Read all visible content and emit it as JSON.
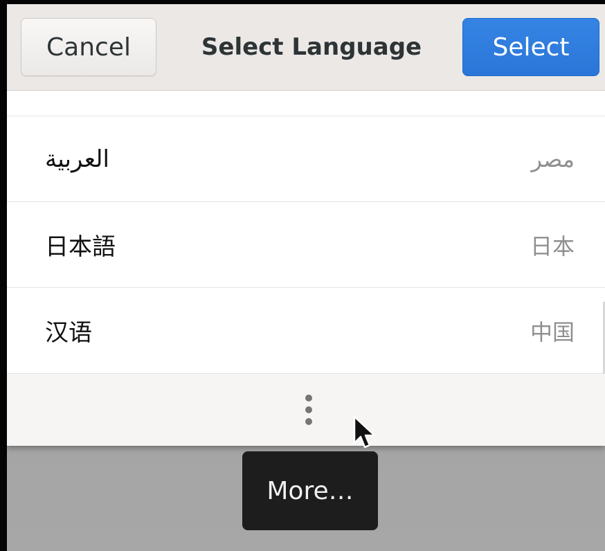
{
  "dialog": {
    "title": "Select Language",
    "cancel_label": "Cancel",
    "select_label": "Select"
  },
  "languages": [
    {
      "name": "العربية",
      "region": "مصر"
    },
    {
      "name": "日本語",
      "region": "日本"
    },
    {
      "name": "汉语",
      "region": "中国"
    }
  ],
  "more_button": {
    "icon": "view-more-icon",
    "tooltip": "More…"
  },
  "colors": {
    "accent": "#3584e4",
    "header_bg": "#ebe8e6",
    "tooltip_bg": "#1d1d1d"
  }
}
